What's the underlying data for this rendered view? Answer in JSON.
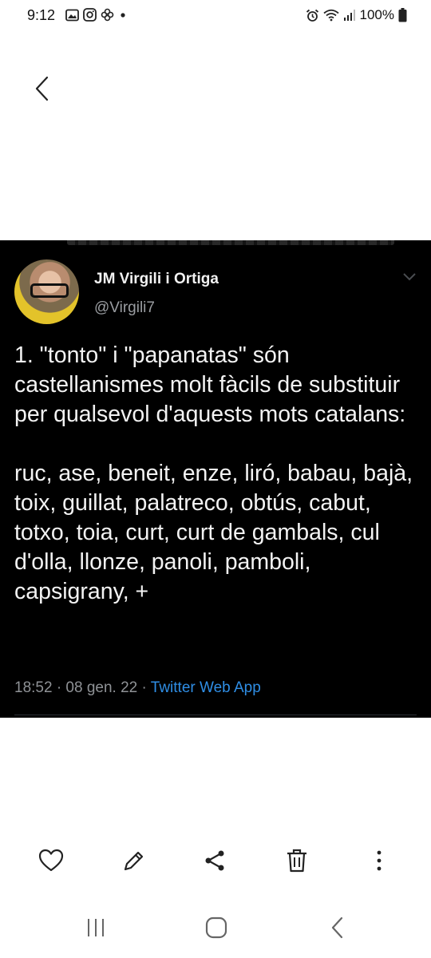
{
  "status_bar": {
    "time": "9:12",
    "battery": "100%",
    "left_icons": [
      "gallery-icon",
      "instagram-icon",
      "pinwheel-icon",
      "dot-icon"
    ],
    "right_icons": [
      "alarm-icon",
      "wifi-icon",
      "signal-icon",
      "battery-icon"
    ]
  },
  "tweet": {
    "author_name": "JM Virgili i Ortiga",
    "handle": "@Virgili7",
    "text": "1. \"tonto\" i \"papanatas\" són castellanismes molt fàcils de substituir per qualsevol d'aquests mots catalans:\n\nruc, ase, beneit, enze, liró, babau, bajà, toix, guillat, palatreco, obtús, cabut, totxo, toia, curt, curt de gambals, cul d'olla, llonze, panoli, pamboli, capsigrany, +",
    "meta": "18:52 · 08 gen. 22 · ",
    "source": "Twitter Web App"
  },
  "actions": [
    "heart-icon",
    "edit-icon",
    "share-icon",
    "delete-icon",
    "more-icon"
  ],
  "nav": [
    "recents-icon",
    "home-icon",
    "back-icon"
  ],
  "colors": {
    "tweet_bg": "#000000",
    "link": "#2f8ee5",
    "page_bg": "#ffffff"
  }
}
